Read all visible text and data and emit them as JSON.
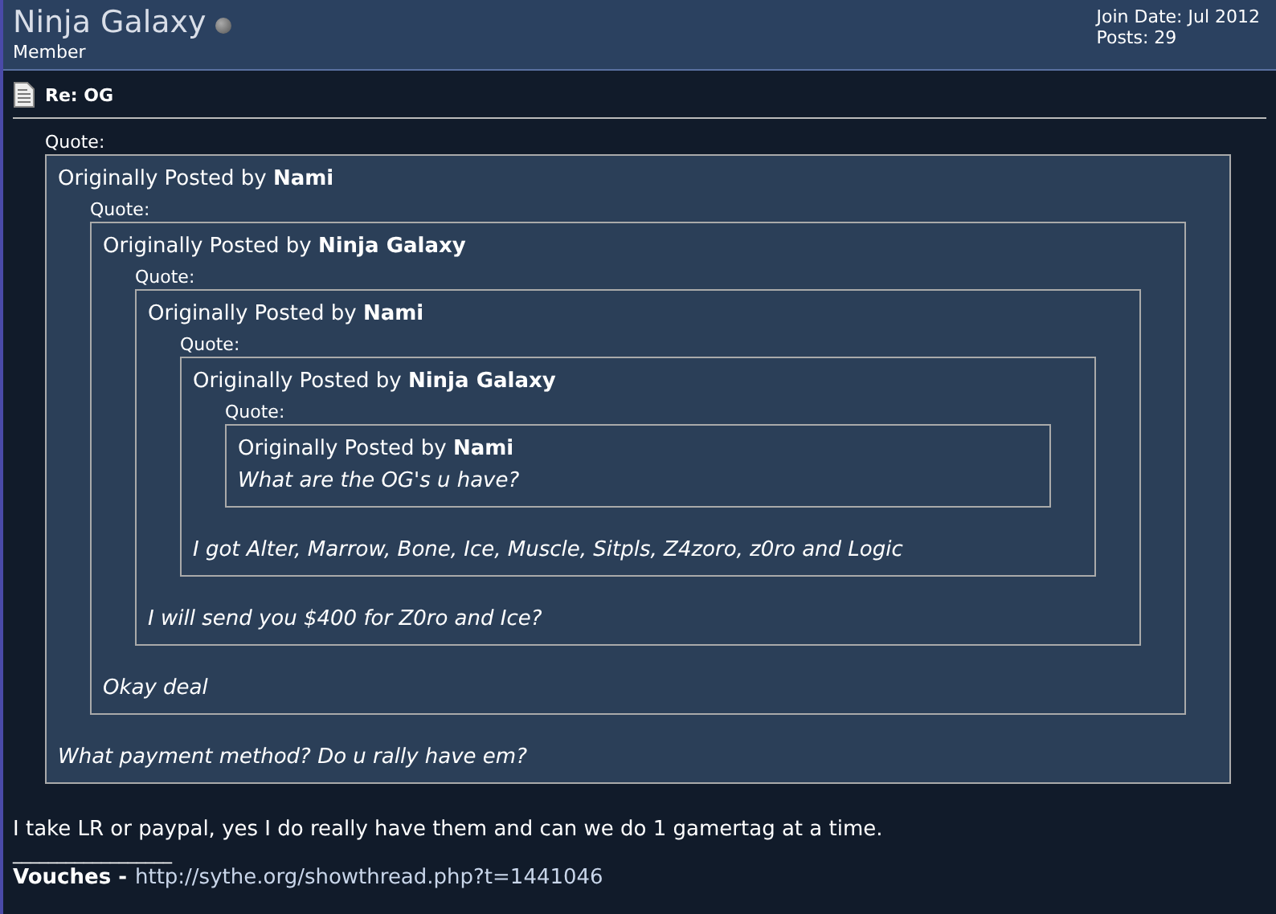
{
  "user": {
    "name": "Ninja Galaxy",
    "online": false,
    "rank": "Member",
    "join_date": "Join Date: Jul 2012",
    "posts": "Posts: 29"
  },
  "post": {
    "title": "Re: OG",
    "quote": {
      "label": "Quote:",
      "byline": "Originally Posted by **Nami**",
      "quote": {
        "label": "Quote:",
        "byline": "Originally Posted by **Ninja Galaxy**",
        "quote": {
          "label": "Quote:",
          "byline": "Originally Posted by **Nami**",
          "quote": {
            "label": "Quote:",
            "byline": "Originally Posted by **Ninja Galaxy**",
            "quote": {
              "label": "Quote:",
              "byline": "Originally Posted by **Nami**",
              "message": "What are the OG's u have?"
            },
            "message": "I got Alter, Marrow, Bone, Ice, Muscle, Sitpls, Z4zoro, z0ro and Logic"
          },
          "message": "I will send you $400 for Z0ro and Ice?"
        },
        "message": "Okay deal"
      },
      "message": "What payment method? Do u rally have em?"
    },
    "body": "I take LR or paypal, yes I do really have them and can we do 1 gamertag at a time.",
    "signature": {
      "separator": "__________________",
      "label": "Vouches -",
      "link": "http://sythe.org/showthread.php?t=1441046"
    }
  }
}
